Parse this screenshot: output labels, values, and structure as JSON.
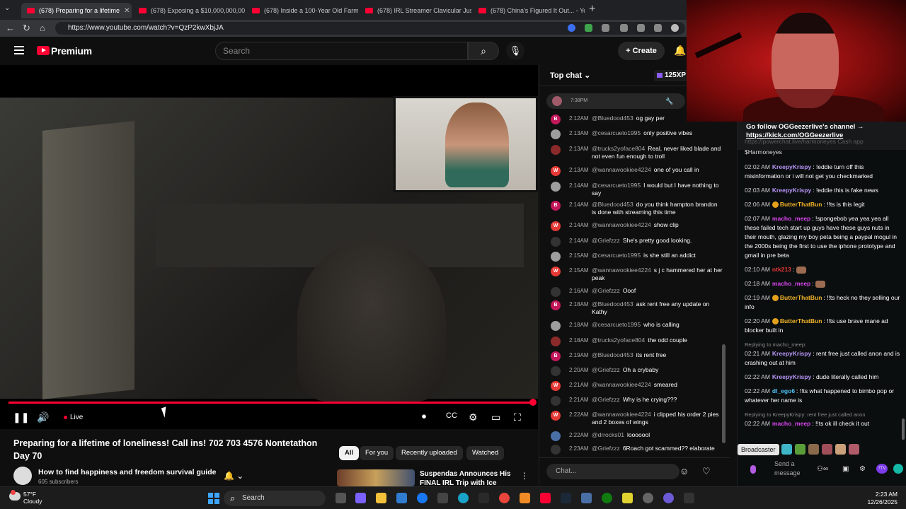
{
  "browser": {
    "tabs": [
      {
        "label": "(678) Preparing for a lifetime",
        "active": true
      },
      {
        "label": "(678) Exposing a $10,000,000,000",
        "active": false
      },
      {
        "label": "(678) Inside a 100-Year Old Farm",
        "active": false
      },
      {
        "label": "(678) IRL Streamer Clavicular Just",
        "active": false
      },
      {
        "label": "(678) China's Figured It Out... - Yo",
        "active": false
      }
    ],
    "url": "https://www.youtube.com/watch?v=QzP2kwXbjJA"
  },
  "header": {
    "brand": "Premium",
    "search_placeholder": "Search",
    "create_label": "Create"
  },
  "player": {
    "live_label": "Live"
  },
  "video": {
    "title": "Preparing for a lifetime of loneliness! Call ins! 702 703 4576 Nontetathon Day 70",
    "channel": "How to find happiness and freedom survival guide",
    "subscribers": "605 subscribers"
  },
  "filters": [
    "All",
    "For you",
    "Recently uploaded",
    "Watched"
  ],
  "recommended": {
    "title": "Suspendas Announces His FINAL IRL Trip with Ice"
  },
  "youtube_chat": {
    "header": "Top chat",
    "xp": "125XP",
    "pinned_time": "7:38PM",
    "input_placeholder": "Chat...",
    "messages": [
      {
        "time": "2:12AM",
        "user": "@Bluedood453",
        "text": "og gay per",
        "avatar_letter": "B",
        "avatar_color": "#c2185b"
      },
      {
        "time": "2:13AM",
        "user": "@cesarcueto1995",
        "text": "only positive vibes",
        "avatar_letter": "",
        "avatar_color": "#9e9e9e"
      },
      {
        "time": "2:13AM",
        "user": "@trucks2yoface804",
        "text": "Real, never liked blade and not even fun enough to troll",
        "avatar_letter": "",
        "avatar_color": "#8b2a2a"
      },
      {
        "time": "2:13AM",
        "user": "@wannawookiee4224",
        "text": "one of you call in",
        "avatar_letter": "W",
        "avatar_color": "#e53935"
      },
      {
        "time": "2:14AM",
        "user": "@cesarcueto1995",
        "text": "I would but I have nothing to say",
        "avatar_letter": "",
        "avatar_color": "#9e9e9e"
      },
      {
        "time": "2:14AM",
        "user": "@Bluedood453",
        "text": "do you think hampton brandon is done with streaming this time",
        "avatar_letter": "B",
        "avatar_color": "#c2185b"
      },
      {
        "time": "2:14AM",
        "user": "@wannawookiee4224",
        "text": "show clip",
        "avatar_letter": "W",
        "avatar_color": "#e53935"
      },
      {
        "time": "2:14AM",
        "user": "@Griefzzz",
        "text": "She's pretty good looking.",
        "avatar_letter": "",
        "avatar_color": "#333333"
      },
      {
        "time": "2:15AM",
        "user": "@cesarcueto1995",
        "text": "is she still an addict",
        "avatar_letter": "",
        "avatar_color": "#9e9e9e"
      },
      {
        "time": "2:15AM",
        "user": "@wannawookiee4224",
        "text": "s j c hammered her at her peak",
        "avatar_letter": "W",
        "avatar_color": "#e53935"
      },
      {
        "time": "2:16AM",
        "user": "@Griefzzz",
        "text": "Ooof",
        "avatar_letter": "",
        "avatar_color": "#333333"
      },
      {
        "time": "2:18AM",
        "user": "@Bluedood453",
        "text": "ask rent free any update on Kathy",
        "avatar_letter": "B",
        "avatar_color": "#c2185b"
      },
      {
        "time": "2:18AM",
        "user": "@cesarcueto1995",
        "text": "who is calling",
        "avatar_letter": "",
        "avatar_color": "#9e9e9e"
      },
      {
        "time": "2:18AM",
        "user": "@trucks2yoface804",
        "text": "the odd couple",
        "avatar_letter": "",
        "avatar_color": "#8b2a2a"
      },
      {
        "time": "2:19AM",
        "user": "@Bluedood453",
        "text": "its rent free",
        "avatar_letter": "B",
        "avatar_color": "#c2185b"
      },
      {
        "time": "2:20AM",
        "user": "@Griefzzz",
        "text": "Oh a crybaby",
        "avatar_letter": "",
        "avatar_color": "#333333"
      },
      {
        "time": "2:21AM",
        "user": "@wannawookiee4224",
        "text": "smeared",
        "avatar_letter": "W",
        "avatar_color": "#e53935"
      },
      {
        "time": "2:21AM",
        "user": "@Griefzzz",
        "text": "Why is he crying???",
        "avatar_letter": "",
        "avatar_color": "#333333"
      },
      {
        "time": "2:22AM",
        "user": "@wannawookiee4224",
        "text": "i clipped his order 2 pies and 2 boxes of wings",
        "avatar_letter": "W",
        "avatar_color": "#e53935"
      },
      {
        "time": "2:22AM",
        "user": "@drrocks01",
        "text": "looooool",
        "avatar_letter": "",
        "avatar_color": "#4a6fa5"
      },
      {
        "time": "2:23AM",
        "user": "@Griefzzz",
        "text": "6Roach got scammed?? elaborate",
        "avatar_letter": "",
        "avatar_color": "#333333"
      }
    ]
  },
  "kick_chat": {
    "banner_line1": "Go follow OGGeezerlive's channel →",
    "banner_link": "https://kick.com/OGGeezerlive",
    "prev_line1": "https://powerchat.live/harmoneyes Cash app",
    "prev_line2": "$Harmoneyes",
    "broadcaster_label": "Broadcaster",
    "send_placeholder": "Send a message",
    "messages": [
      {
        "time": "02:02 AM",
        "user": "KreepyKrispy",
        "user_color": "#b794f6",
        "badge": false,
        "reply": "",
        "text": "!eddie turn off this misinformation or i will not get you checkmarked"
      },
      {
        "time": "02:03 AM",
        "user": "KreepyKrispy",
        "user_color": "#b794f6",
        "badge": false,
        "reply": "",
        "text": "!eddie this is fake news"
      },
      {
        "time": "02:06 AM",
        "user": "ButterThatBun",
        "user_color": "#f0b429",
        "badge": true,
        "reply": "",
        "text": "!!ts is this legit"
      },
      {
        "time": "02:07 AM",
        "user": "macho_meep",
        "user_color": "#d946ef",
        "badge": false,
        "reply": "",
        "text": "!spongebob yea yea yea all these failed tech start up guys have these guys nuts in their mouth, glazing my boy peta being a paypal mogul in the 2000s being the first to use the iphone prototype and gmail in pre beta"
      },
      {
        "time": "02:10 AM",
        "user": "ntk213",
        "user_color": "#e53935",
        "badge": false,
        "reply": "",
        "text": ""
      },
      {
        "time": "02:18 AM",
        "user": "macho_meep",
        "user_color": "#d946ef",
        "badge": false,
        "reply": "",
        "text": ""
      },
      {
        "time": "02:19 AM",
        "user": "ButterThatBun",
        "user_color": "#f0b429",
        "badge": true,
        "reply": "",
        "text": "!!ts  heck no they selling our info"
      },
      {
        "time": "02:20 AM",
        "user": "ButterThatBun",
        "user_color": "#f0b429",
        "badge": true,
        "reply": "",
        "text": "!!ts use brave mane ad blocker built in"
      },
      {
        "time": "02:21 AM",
        "user": "KreepyKrispy",
        "user_color": "#b794f6",
        "badge": false,
        "reply": "Replying to macho_meep:",
        "text": "rent free just called anon and is crashing out at him"
      },
      {
        "time": "02:22 AM",
        "user": "KreepyKrispy",
        "user_color": "#b794f6",
        "badge": false,
        "reply": "",
        "text": "dude literally called him"
      },
      {
        "time": "02:22 AM",
        "user": "dl_ego6",
        "user_color": "#4fc3f7",
        "badge": false,
        "reply": "",
        "text": "!!ts what happened to bimbo pop or whatever her name is"
      },
      {
        "time": "02:22 AM",
        "user": "macho_meep",
        "user_color": "#d946ef",
        "badge": false,
        "reply": "Replying to KreepyKrispy: rent free just called anon",
        "text": "!!ts ok ill check it out"
      }
    ]
  },
  "taskbar": {
    "temperature": "57°F",
    "condition": "Cloudy",
    "search_label": "Search",
    "time": "2:23 AM",
    "date": "12/26/2025"
  }
}
